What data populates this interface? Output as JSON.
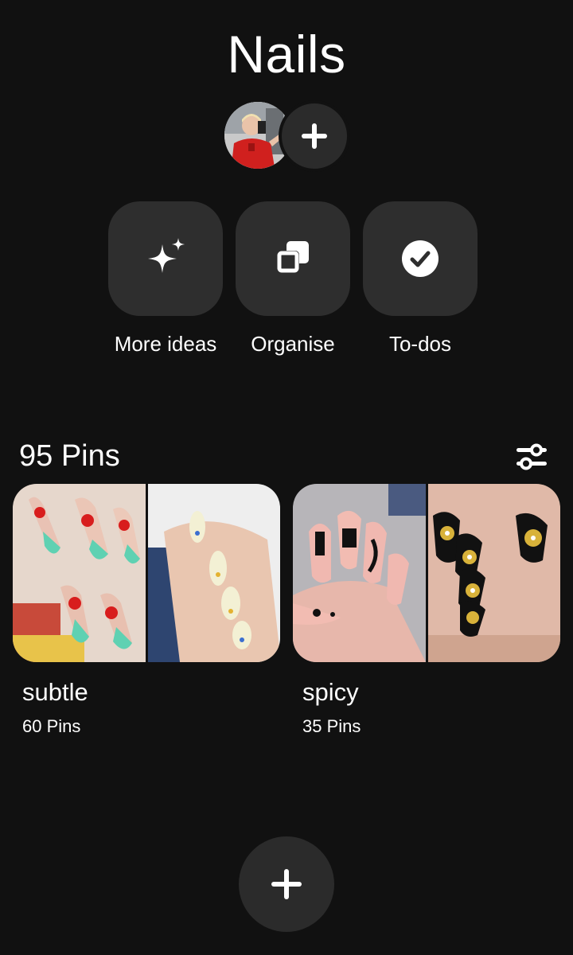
{
  "board": {
    "title": "Nails"
  },
  "collaborators": {
    "avatar_alt": "Board owner avatar",
    "add_icon": "plus-icon"
  },
  "actions": [
    {
      "label": "More ideas",
      "icon": "sparkle-icon"
    },
    {
      "label": "Organise",
      "icon": "organise-icon"
    },
    {
      "label": "To-dos",
      "icon": "check-circle-icon"
    }
  ],
  "pins_header": {
    "count_label": "95 Pins",
    "filter_icon": "filter-sliders-icon"
  },
  "sections": [
    {
      "name": "subtle",
      "pin_count": "60 Pins"
    },
    {
      "name": "spicy",
      "pin_count": "35 Pins"
    }
  ],
  "fab": {
    "icon": "plus-icon"
  },
  "colors": {
    "background": "#111111",
    "tile": "#2e2e2e",
    "text": "#ffffff"
  }
}
